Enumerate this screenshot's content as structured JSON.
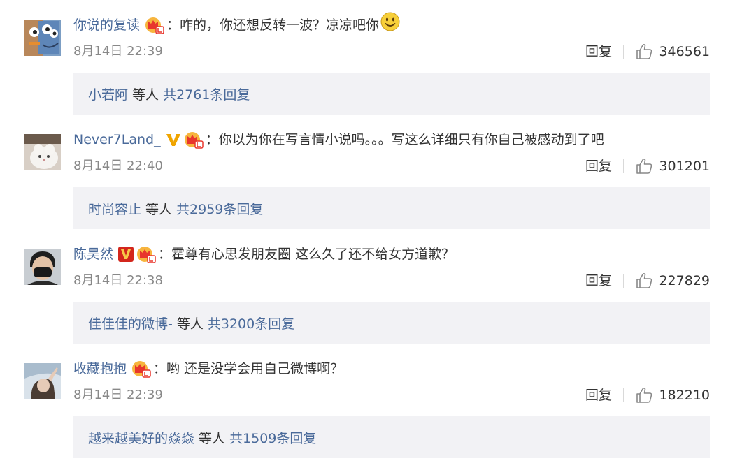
{
  "comments": [
    {
      "username": "你说的复读",
      "badges": [
        "vip-crown"
      ],
      "text": "咋的，你还想反转一波？凉凉吧你",
      "emoji": "smile-emoji",
      "time": "8月14日 22:39",
      "reply_label": "回复",
      "likes": "346561",
      "reply_users": "小若阿",
      "reply_etc": "等人",
      "reply_total": "共2761条回复"
    },
    {
      "username": "Never7Land_",
      "badges": [
        "verified-v-gold",
        "vip-crown"
      ],
      "text": "你以为你在写言情小说吗。。。写这么详细只有你自己被感动到了吧",
      "emoji": "",
      "time": "8月14日 22:40",
      "reply_label": "回复",
      "likes": "301201",
      "reply_users": "时尚容止",
      "reply_etc": "等人",
      "reply_total": "共2959条回复"
    },
    {
      "username": "陈昊然",
      "badges": [
        "verified-v-red",
        "vip-crown"
      ],
      "text": "霍尊有心思发朋友圈 这么久了还不给女方道歉？",
      "emoji": "",
      "time": "8月14日 22:38",
      "reply_label": "回复",
      "likes": "227829",
      "reply_users": "佳佳佳的微博-",
      "reply_etc": "等人",
      "reply_total": "共3200条回复"
    },
    {
      "username": "收藏抱抱",
      "badges": [
        "vip-crown"
      ],
      "text": "哟 还是没学会用自己微博啊？",
      "emoji": "",
      "time": "8月14日 22:39",
      "reply_label": "回复",
      "likes": "182210",
      "reply_users": "越来越美好的焱焱",
      "reply_etc": "等人",
      "reply_total": "共1509条回复"
    }
  ],
  "colors": {
    "link": "#4a6a9a",
    "text": "#333333",
    "time": "#888888",
    "reply_bg": "#f2f2f5",
    "verified_gold": "#f0a500",
    "verified_red": "#d3261c"
  }
}
